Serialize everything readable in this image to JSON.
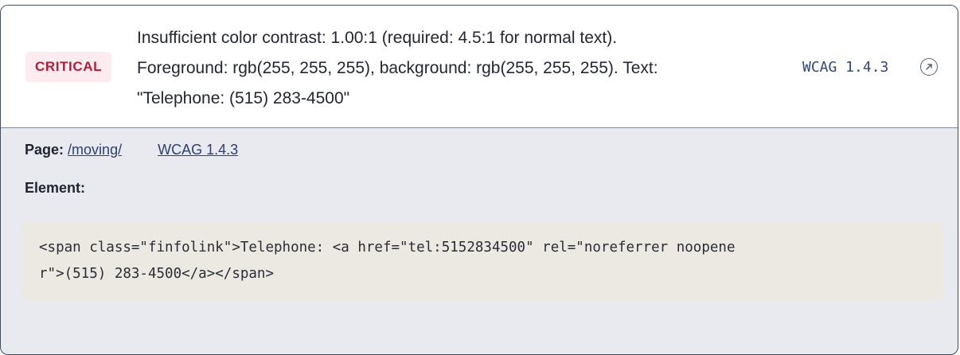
{
  "issue": {
    "severity": "CRITICAL",
    "message_lines": [
      "Insufficient color contrast: 1.00:1 (required: 4.5:1 for normal text).",
      "Foreground: rgb(255, 255, 255), background: rgb(255, 255, 255). Text:",
      "\"Telephone: (515) 283-4500\""
    ],
    "wcag_code": "WCAG 1.4.3",
    "toggle_icon": "expand-collapse-icon"
  },
  "details": {
    "page_label": "Page:",
    "page_link": "/moving/",
    "wcag_link": "WCAG 1.4.3",
    "element_label": "Element:",
    "code_lines": [
      "<span class=\"finfolink\">Telephone: <a href=\"tel:5152834500\" rel=\"noreferrer noopene",
      "r\">(515) 283-4500</a></span>"
    ]
  },
  "colors": {
    "badge_text": "#b51c3a",
    "badge_bg": "#fcecef",
    "link": "#2d3f73",
    "code_bg": "#ece9e2",
    "details_bg": "#e9eaef"
  }
}
